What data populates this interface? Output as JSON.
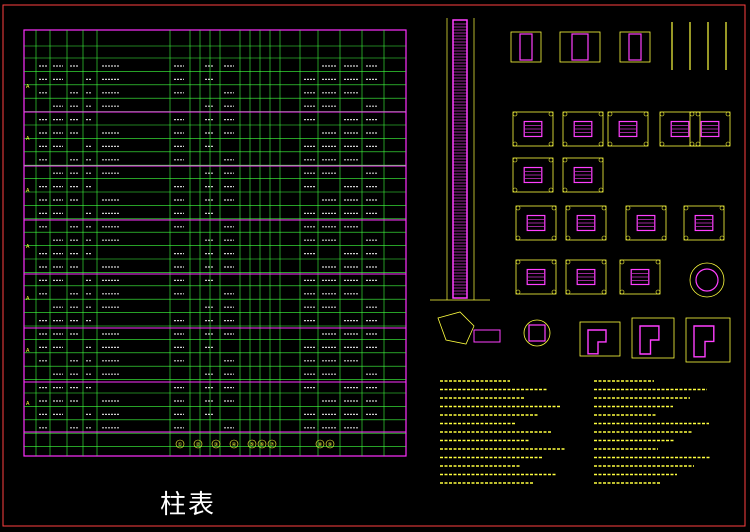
{
  "caption": "柱表",
  "colors": {
    "frame": "#ff3f3f",
    "table_border": "#ff2fff",
    "grid": "#3fff3f",
    "text": "#ffff3f",
    "section_rebar": "#ff3fff",
    "background": "#000000"
  },
  "table": {
    "bottom_labels": [
      "①",
      "②",
      "③",
      "④",
      "⑤",
      "⑥",
      "⑦",
      "⑧",
      "⑨"
    ]
  },
  "icons": [
    "column-section-icon",
    "rebar-detail-icon",
    "round-column-icon",
    "joint-detail-icon"
  ]
}
